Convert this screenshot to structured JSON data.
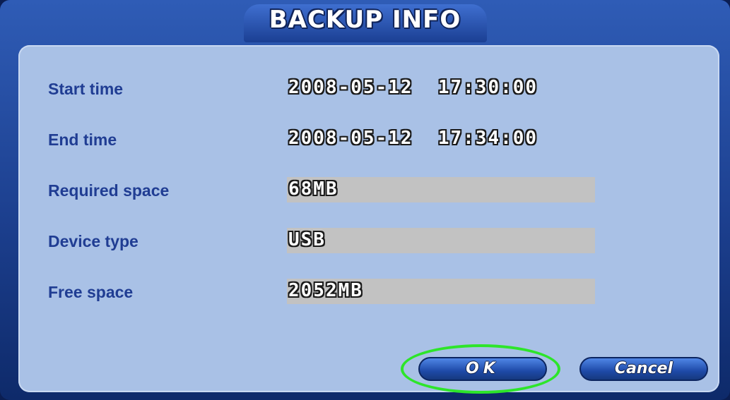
{
  "dialog": {
    "title": "BACKUP INFO"
  },
  "fields": [
    {
      "label": "Start time",
      "value": "2008-05-12  17:30:00"
    },
    {
      "label": "End time",
      "value": "2008-05-12  17:34:00"
    },
    {
      "label": "Required space",
      "value": "68MB"
    },
    {
      "label": "Device type",
      "value": "USB"
    },
    {
      "label": "Free space",
      "value": "2052MB"
    }
  ],
  "buttons": {
    "ok_label": "OK",
    "cancel_label": "Cancel"
  },
  "colors": {
    "panel": "#a9c1e6",
    "label_text": "#203d93",
    "value_box": "#c2c2c2",
    "highlight": "#2de52a"
  }
}
